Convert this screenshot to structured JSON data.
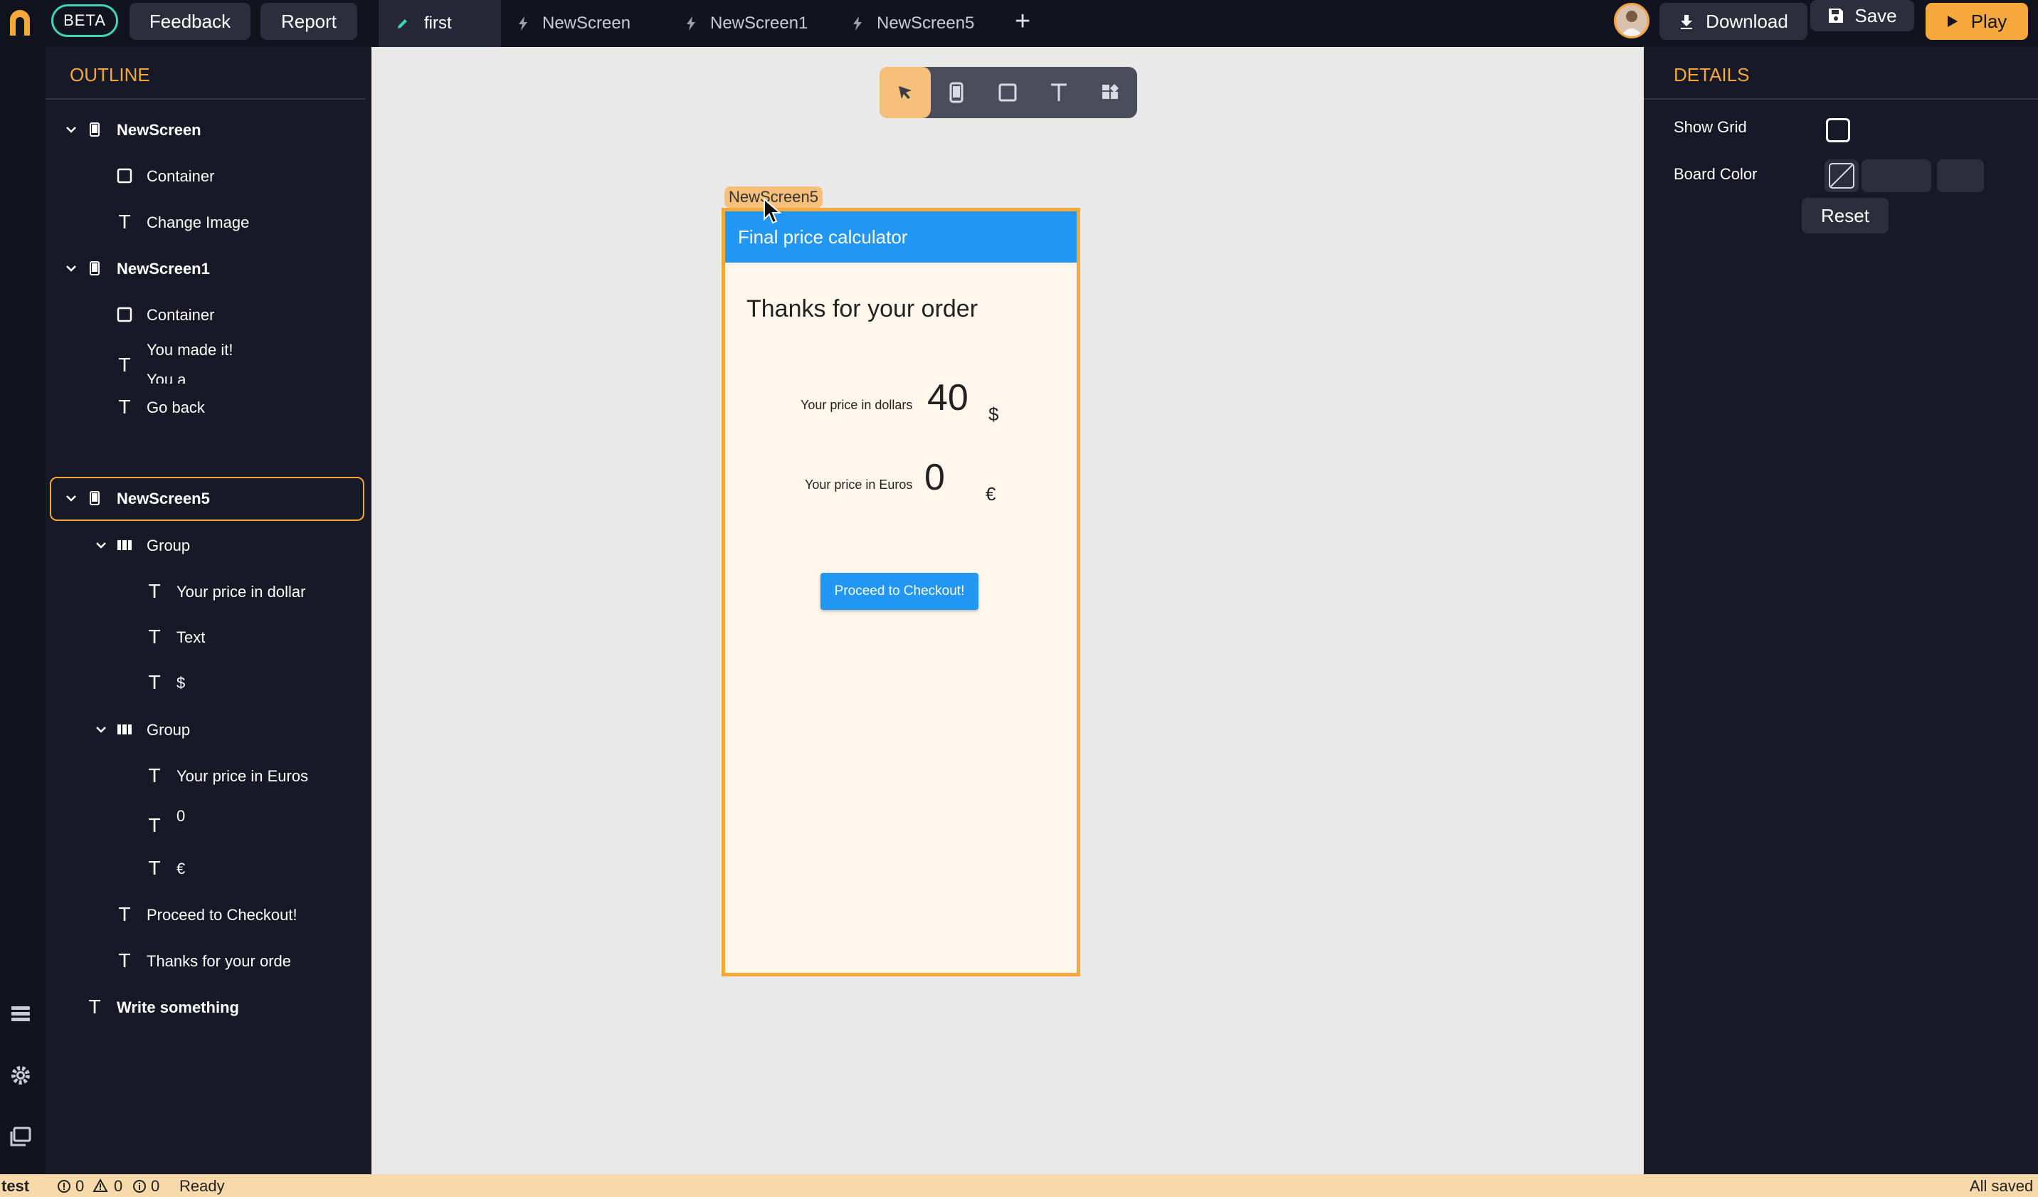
{
  "topbar": {
    "beta": "BETA",
    "feedback": "Feedback",
    "report": "Report",
    "tabs": [
      {
        "label": "first",
        "active": true
      },
      {
        "label": "NewScreen",
        "active": false
      },
      {
        "label": "NewScreen1",
        "active": false
      },
      {
        "label": "NewScreen5",
        "active": false
      }
    ],
    "download": "Download",
    "save": "Save",
    "play": "Play"
  },
  "outline": {
    "title": "OUTLINE",
    "items": [
      {
        "label": "NewScreen",
        "icon": "phone-icon",
        "bold": true
      },
      {
        "label": "Container",
        "icon": "container-icon"
      },
      {
        "label": "Change Image",
        "icon": "text-icon"
      },
      {
        "label": "NewScreen1",
        "icon": "phone-icon",
        "bold": true
      },
      {
        "label": "Container",
        "icon": "container-icon"
      },
      {
        "label": "You made it!",
        "sub": "You a",
        "icon": "text-icon"
      },
      {
        "label": "Go back",
        "icon": "text-icon"
      },
      {
        "label": "NewScreen5",
        "icon": "phone-icon",
        "bold": true,
        "selected": true
      },
      {
        "label": "Group",
        "icon": "group-icon"
      },
      {
        "label": "Your price in dollar",
        "icon": "text-icon"
      },
      {
        "label": "Text",
        "icon": "text-icon"
      },
      {
        "label": "$",
        "icon": "text-icon"
      },
      {
        "label": "Group",
        "icon": "group-icon"
      },
      {
        "label": "Your price in Euros",
        "icon": "text-icon"
      },
      {
        "label": "0",
        "icon": "text-icon"
      },
      {
        "label": "€",
        "icon": "text-icon"
      },
      {
        "label": "Proceed to Checkout!",
        "icon": "text-icon"
      },
      {
        "label": "Thanks for your orde",
        "icon": "text-icon"
      },
      {
        "label": "Write something",
        "icon": "text-icon",
        "bold": true
      }
    ]
  },
  "canvas": {
    "screen_label": "NewScreen5",
    "app_title": "Final price calculator",
    "heading": "Thanks for your order",
    "dollar_label": "Your price in dollars",
    "dollar_value": "40",
    "dollar_symbol": "$",
    "euro_label": "Your price in Euros",
    "euro_value": "0",
    "euro_symbol": "€",
    "checkout_button": "Proceed to Checkout!"
  },
  "details": {
    "title": "DETAILS",
    "show_grid": "Show Grid",
    "board_color": "Board Color",
    "reset": "Reset"
  },
  "status": {
    "project": "test",
    "errors": "0",
    "warnings": "0",
    "infos": "0",
    "state": "Ready",
    "saved": "All saved"
  },
  "colors": {
    "accent": "#f7a83a",
    "panel": "#171a26",
    "topbar": "#11131e",
    "appbar": "#2196f3",
    "screen_bg": "#fff7ec"
  }
}
